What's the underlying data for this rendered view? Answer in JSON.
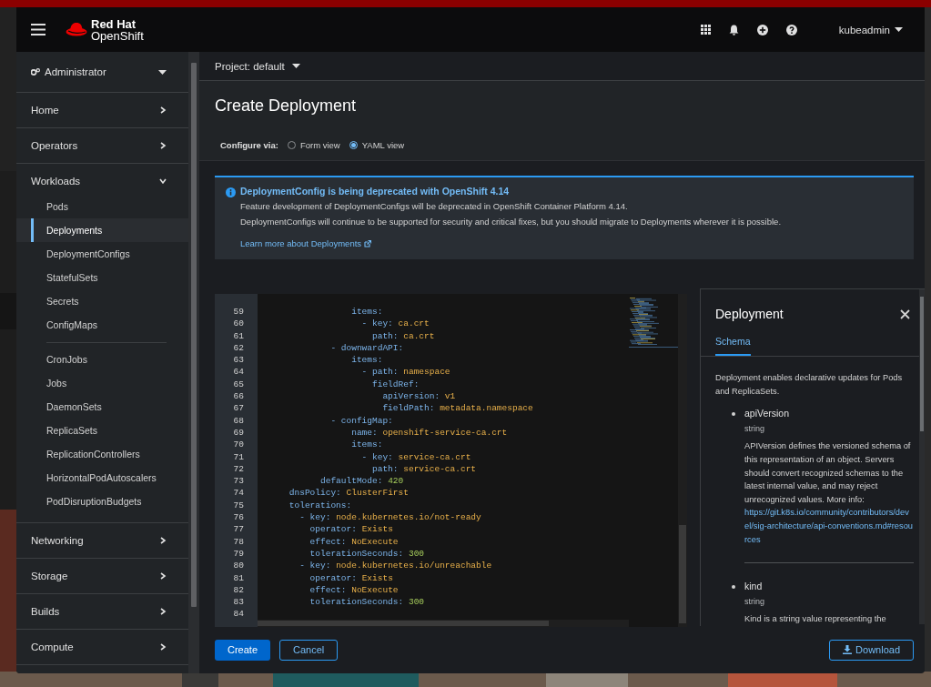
{
  "masthead": {
    "logo": {
      "line_1": "Red Hat",
      "line_2": "OpenShift"
    },
    "user": "kubeadmin"
  },
  "sidebar": {
    "perspective": "Administrator",
    "sections": [
      {
        "label": "Home",
        "expanded": false
      },
      {
        "label": "Operators",
        "expanded": false
      },
      {
        "label": "Workloads",
        "expanded": true,
        "groups": [
          {
            "children": [
              {
                "label": "Pods",
                "selected": false
              },
              {
                "label": "Deployments",
                "selected": true
              },
              {
                "label": "DeploymentConfigs",
                "selected": false
              },
              {
                "label": "StatefulSets",
                "selected": false
              },
              {
                "label": "Secrets",
                "selected": false
              },
              {
                "label": "ConfigMaps",
                "selected": false
              }
            ]
          },
          {
            "children": [
              {
                "label": "CronJobs",
                "selected": false
              },
              {
                "label": "Jobs",
                "selected": false
              },
              {
                "label": "DaemonSets",
                "selected": false
              },
              {
                "label": "ReplicaSets",
                "selected": false
              },
              {
                "label": "ReplicationControllers",
                "selected": false
              },
              {
                "label": "HorizontalPodAutoscalers",
                "selected": false
              },
              {
                "label": "PodDisruptionBudgets",
                "selected": false
              }
            ]
          }
        ]
      },
      {
        "label": "Networking",
        "expanded": false
      },
      {
        "label": "Storage",
        "expanded": false
      },
      {
        "label": "Builds",
        "expanded": false
      },
      {
        "label": "Compute",
        "expanded": false
      }
    ]
  },
  "project_bar": {
    "label": "Project: default"
  },
  "page": {
    "title": "Create Deployment",
    "configure_label": "Configure via:",
    "options": [
      {
        "label": "Form view",
        "selected": false
      },
      {
        "label": "YAML view",
        "selected": true
      }
    ]
  },
  "alert": {
    "title": "DeploymentConfig is being deprecated with OpenShift 4.14",
    "lines": [
      "Feature development of DeploymentConfigs will be deprecated in OpenShift Container Platform 4.14.",
      "DeploymentConfigs will continue to be supported for security and critical fixes, but you should migrate to Deployments wherever it is possible."
    ],
    "link": "Learn more about Deployments"
  },
  "editor": {
    "lines": [
      {
        "number": "59",
        "key": "                items:"
      },
      {
        "number": "60",
        "key": "                  - key:",
        "value": "ca.crt",
        "kind": "string"
      },
      {
        "number": "61",
        "key": "                    path:",
        "value": "ca.crt",
        "kind": "string"
      },
      {
        "number": "62",
        "key": "            - downwardAPI:"
      },
      {
        "number": "63",
        "key": "                items:"
      },
      {
        "number": "64",
        "key": "                  - path:",
        "value": "namespace",
        "kind": "string"
      },
      {
        "number": "65",
        "key": "                    fieldRef:"
      },
      {
        "number": "66",
        "key": "                      apiVersion:",
        "value": "v1",
        "kind": "string"
      },
      {
        "number": "67",
        "key": "                      fieldPath:",
        "value": "metadata.namespace",
        "kind": "string"
      },
      {
        "number": "68",
        "key": "            - configMap:"
      },
      {
        "number": "69",
        "key": "                name:",
        "value": "openshift-service-ca.crt",
        "kind": "string"
      },
      {
        "number": "70",
        "key": "                items:"
      },
      {
        "number": "71",
        "key": "                  - key:",
        "value": "service-ca.crt",
        "kind": "string"
      },
      {
        "number": "72",
        "key": "                    path:",
        "value": "service-ca.crt",
        "kind": "string"
      },
      {
        "number": "73",
        "key": "          defaultMode:",
        "value": "420",
        "kind": "number"
      },
      {
        "number": "74",
        "key": "    dnsPolicy:",
        "value": "ClusterFirst",
        "kind": "string"
      },
      {
        "number": "75",
        "key": "    tolerations:"
      },
      {
        "number": "76",
        "key": "      - key:",
        "value": "node.kubernetes.io/not-ready",
        "kind": "string"
      },
      {
        "number": "77",
        "key": "        operator:",
        "value": "Exists",
        "kind": "string"
      },
      {
        "number": "78",
        "key": "        effect:",
        "value": "NoExecute",
        "kind": "string"
      },
      {
        "number": "79",
        "key": "        tolerationSeconds:",
        "value": "300",
        "kind": "number"
      },
      {
        "number": "80",
        "key": "      - key:",
        "value": "node.kubernetes.io/unreachable",
        "kind": "string"
      },
      {
        "number": "81",
        "key": "        operator:",
        "value": "Exists",
        "kind": "string"
      },
      {
        "number": "82",
        "key": "        effect:",
        "value": "NoExecute",
        "kind": "string"
      },
      {
        "number": "83",
        "key": "        tolerationSeconds:",
        "value": "300",
        "kind": "number"
      },
      {
        "number": "84"
      }
    ]
  },
  "side_panel": {
    "title": "Deployment",
    "tabs": [
      {
        "label": "Schema",
        "selected": true
      }
    ],
    "description": "Deployment enables declarative updates for Pods and ReplicaSets.",
    "properties": [
      {
        "name": "apiVersion",
        "type": "string",
        "description": "APIVersion defines the versioned schema of this representation of an object. Servers should convert recognized schemas to the latest internal value, and may reject unrecognized values. More info:",
        "link": "https://git.k8s.io/community/contributors/devel/sig-architecture/api-conventions.md#resources"
      },
      {
        "name": "kind",
        "type": "string",
        "description": "Kind is a string value representing the"
      }
    ]
  },
  "footer": {
    "buttons": [
      {
        "label": "Create",
        "kind": "primary"
      },
      {
        "label": "Cancel",
        "kind": "secondary"
      }
    ],
    "download": "Download"
  }
}
